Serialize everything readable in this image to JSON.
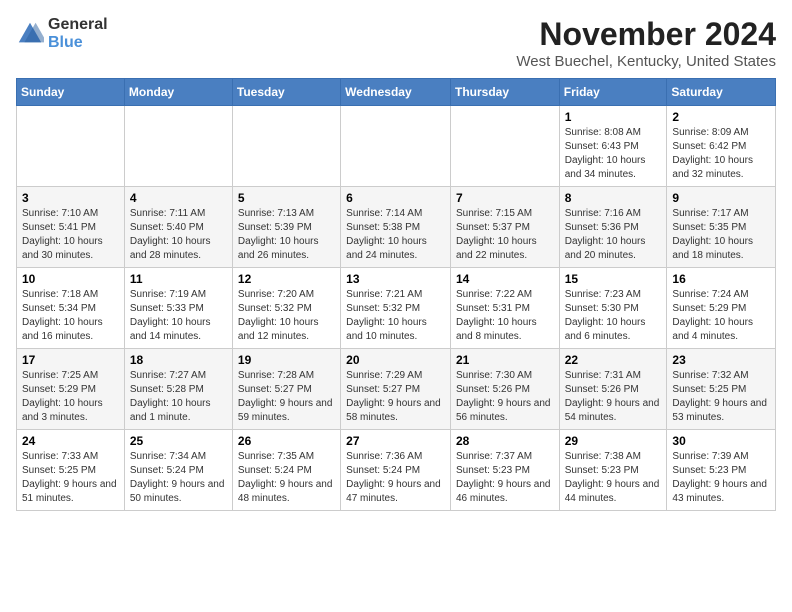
{
  "header": {
    "logo_general": "General",
    "logo_blue": "Blue",
    "month_title": "November 2024",
    "location": "West Buechel, Kentucky, United States"
  },
  "days_of_week": [
    "Sunday",
    "Monday",
    "Tuesday",
    "Wednesday",
    "Thursday",
    "Friday",
    "Saturday"
  ],
  "weeks": [
    [
      {
        "day": "",
        "info": ""
      },
      {
        "day": "",
        "info": ""
      },
      {
        "day": "",
        "info": ""
      },
      {
        "day": "",
        "info": ""
      },
      {
        "day": "",
        "info": ""
      },
      {
        "day": "1",
        "info": "Sunrise: 8:08 AM\nSunset: 6:43 PM\nDaylight: 10 hours and 34 minutes."
      },
      {
        "day": "2",
        "info": "Sunrise: 8:09 AM\nSunset: 6:42 PM\nDaylight: 10 hours and 32 minutes."
      }
    ],
    [
      {
        "day": "3",
        "info": "Sunrise: 7:10 AM\nSunset: 5:41 PM\nDaylight: 10 hours and 30 minutes."
      },
      {
        "day": "4",
        "info": "Sunrise: 7:11 AM\nSunset: 5:40 PM\nDaylight: 10 hours and 28 minutes."
      },
      {
        "day": "5",
        "info": "Sunrise: 7:13 AM\nSunset: 5:39 PM\nDaylight: 10 hours and 26 minutes."
      },
      {
        "day": "6",
        "info": "Sunrise: 7:14 AM\nSunset: 5:38 PM\nDaylight: 10 hours and 24 minutes."
      },
      {
        "day": "7",
        "info": "Sunrise: 7:15 AM\nSunset: 5:37 PM\nDaylight: 10 hours and 22 minutes."
      },
      {
        "day": "8",
        "info": "Sunrise: 7:16 AM\nSunset: 5:36 PM\nDaylight: 10 hours and 20 minutes."
      },
      {
        "day": "9",
        "info": "Sunrise: 7:17 AM\nSunset: 5:35 PM\nDaylight: 10 hours and 18 minutes."
      }
    ],
    [
      {
        "day": "10",
        "info": "Sunrise: 7:18 AM\nSunset: 5:34 PM\nDaylight: 10 hours and 16 minutes."
      },
      {
        "day": "11",
        "info": "Sunrise: 7:19 AM\nSunset: 5:33 PM\nDaylight: 10 hours and 14 minutes."
      },
      {
        "day": "12",
        "info": "Sunrise: 7:20 AM\nSunset: 5:32 PM\nDaylight: 10 hours and 12 minutes."
      },
      {
        "day": "13",
        "info": "Sunrise: 7:21 AM\nSunset: 5:32 PM\nDaylight: 10 hours and 10 minutes."
      },
      {
        "day": "14",
        "info": "Sunrise: 7:22 AM\nSunset: 5:31 PM\nDaylight: 10 hours and 8 minutes."
      },
      {
        "day": "15",
        "info": "Sunrise: 7:23 AM\nSunset: 5:30 PM\nDaylight: 10 hours and 6 minutes."
      },
      {
        "day": "16",
        "info": "Sunrise: 7:24 AM\nSunset: 5:29 PM\nDaylight: 10 hours and 4 minutes."
      }
    ],
    [
      {
        "day": "17",
        "info": "Sunrise: 7:25 AM\nSunset: 5:29 PM\nDaylight: 10 hours and 3 minutes."
      },
      {
        "day": "18",
        "info": "Sunrise: 7:27 AM\nSunset: 5:28 PM\nDaylight: 10 hours and 1 minute."
      },
      {
        "day": "19",
        "info": "Sunrise: 7:28 AM\nSunset: 5:27 PM\nDaylight: 9 hours and 59 minutes."
      },
      {
        "day": "20",
        "info": "Sunrise: 7:29 AM\nSunset: 5:27 PM\nDaylight: 9 hours and 58 minutes."
      },
      {
        "day": "21",
        "info": "Sunrise: 7:30 AM\nSunset: 5:26 PM\nDaylight: 9 hours and 56 minutes."
      },
      {
        "day": "22",
        "info": "Sunrise: 7:31 AM\nSunset: 5:26 PM\nDaylight: 9 hours and 54 minutes."
      },
      {
        "day": "23",
        "info": "Sunrise: 7:32 AM\nSunset: 5:25 PM\nDaylight: 9 hours and 53 minutes."
      }
    ],
    [
      {
        "day": "24",
        "info": "Sunrise: 7:33 AM\nSunset: 5:25 PM\nDaylight: 9 hours and 51 minutes."
      },
      {
        "day": "25",
        "info": "Sunrise: 7:34 AM\nSunset: 5:24 PM\nDaylight: 9 hours and 50 minutes."
      },
      {
        "day": "26",
        "info": "Sunrise: 7:35 AM\nSunset: 5:24 PM\nDaylight: 9 hours and 48 minutes."
      },
      {
        "day": "27",
        "info": "Sunrise: 7:36 AM\nSunset: 5:24 PM\nDaylight: 9 hours and 47 minutes."
      },
      {
        "day": "28",
        "info": "Sunrise: 7:37 AM\nSunset: 5:23 PM\nDaylight: 9 hours and 46 minutes."
      },
      {
        "day": "29",
        "info": "Sunrise: 7:38 AM\nSunset: 5:23 PM\nDaylight: 9 hours and 44 minutes."
      },
      {
        "day": "30",
        "info": "Sunrise: 7:39 AM\nSunset: 5:23 PM\nDaylight: 9 hours and 43 minutes."
      }
    ]
  ]
}
